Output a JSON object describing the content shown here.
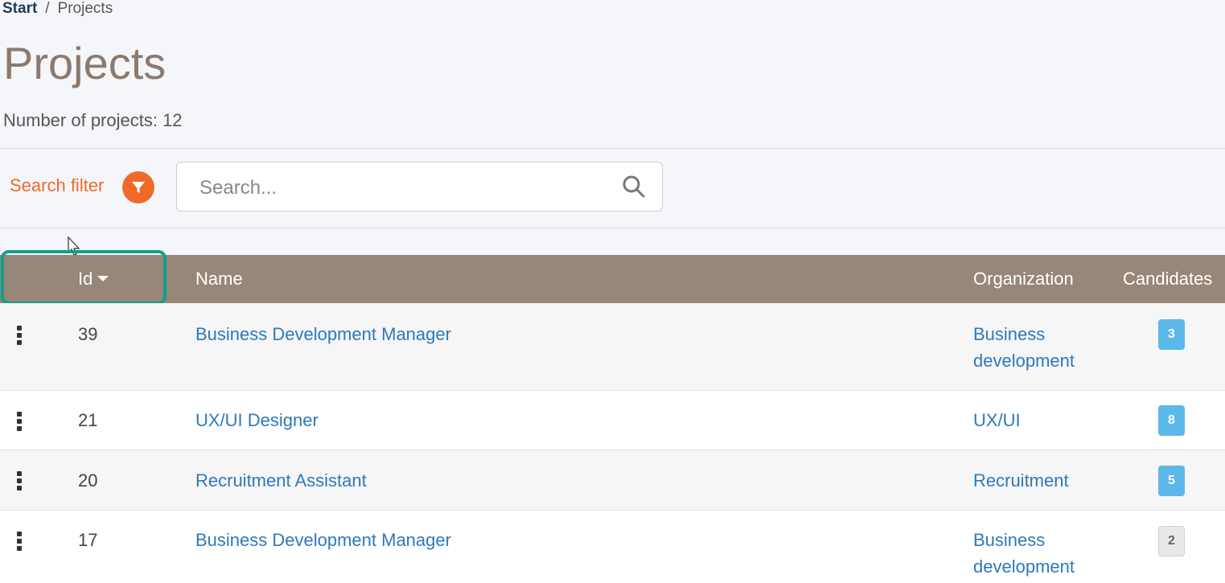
{
  "breadcrumb": {
    "start": "Start",
    "separator": "/",
    "current": "Projects"
  },
  "page": {
    "title": "Projects",
    "count_text": "Number of projects: 12"
  },
  "filter": {
    "label": "Search filter"
  },
  "search": {
    "placeholder": "Search..."
  },
  "table": {
    "headers": {
      "id": "Id",
      "name": "Name",
      "organization": "Organization",
      "candidates": "Candidates"
    },
    "rows": [
      {
        "id": "39",
        "name": "Business Development Manager",
        "org_line1": "Business",
        "org_line2": "development",
        "candidates": "3"
      },
      {
        "id": "21",
        "name": "UX/UI Designer",
        "org_line1": "UX/UI",
        "org_line2": "",
        "candidates": "8"
      },
      {
        "id": "20",
        "name": "Recruitment Assistant",
        "org_line1": "Recruitment",
        "org_line2": "",
        "candidates": "5"
      },
      {
        "id": "17",
        "name": "Business Development Manager",
        "org_line1": "Business",
        "org_line2": "development",
        "candidates": "2"
      }
    ]
  },
  "colors": {
    "accent": "#ef6a2a",
    "header_bg": "#988678",
    "highlight": "#12a08a",
    "link": "#2e79b9",
    "badge": "#5bb8e8"
  }
}
